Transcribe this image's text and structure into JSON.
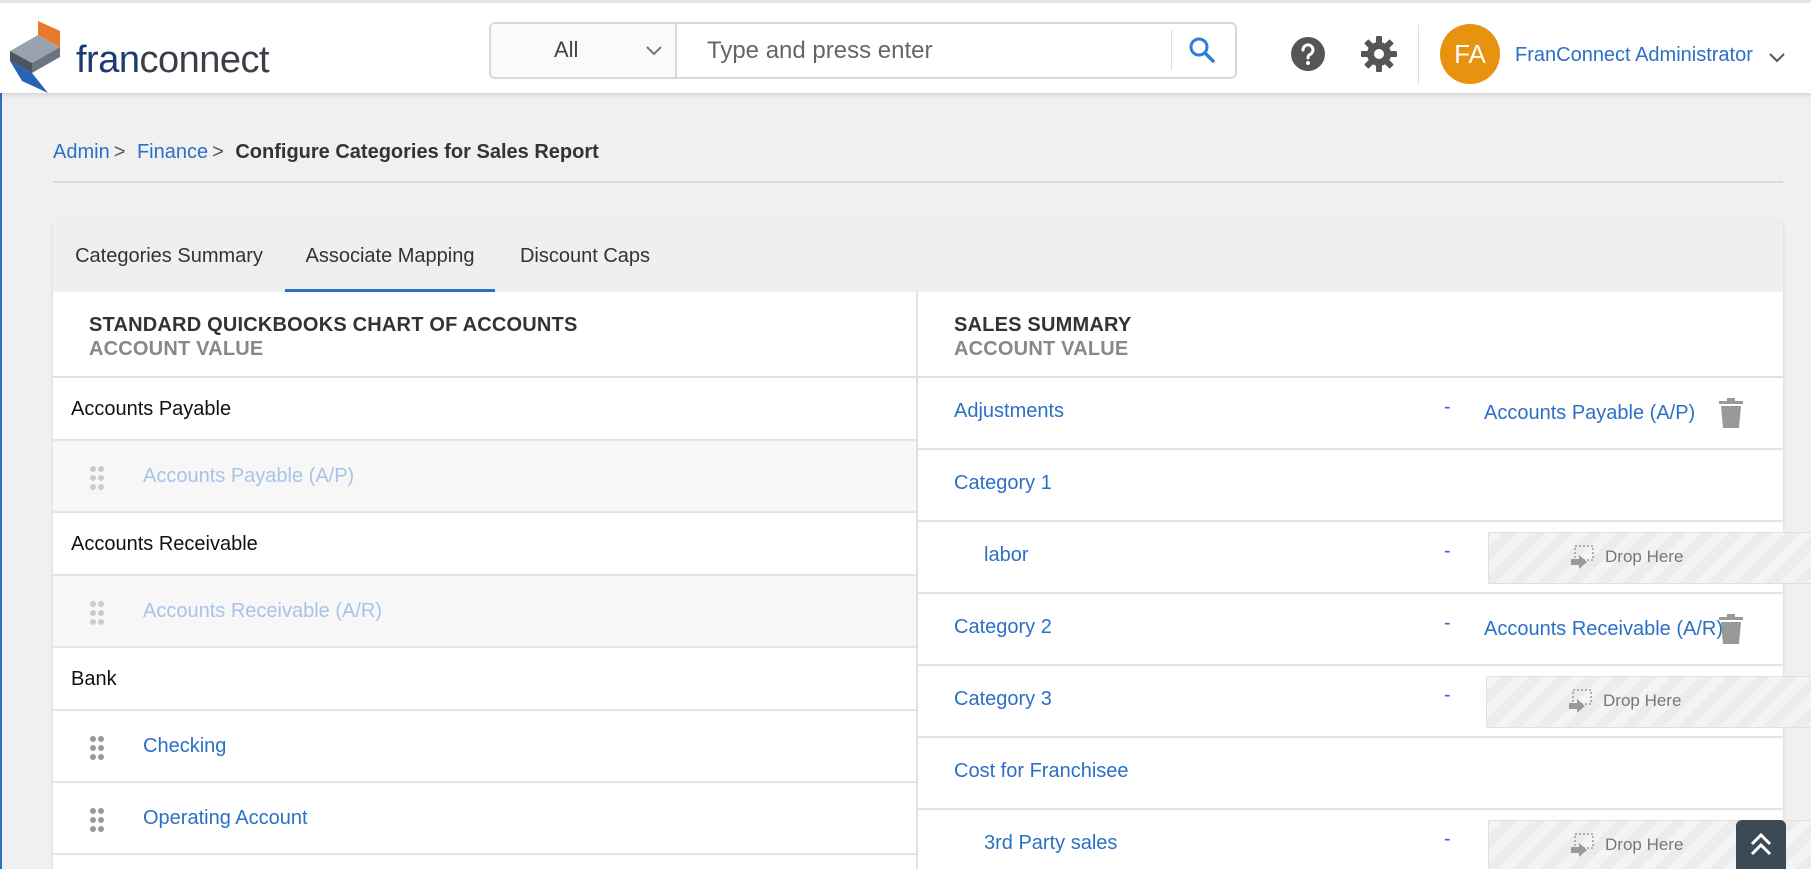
{
  "header": {
    "logo": {
      "part1": "fran",
      "part2": "connect"
    },
    "search": {
      "scope": "All",
      "placeholder": "Type and press enter"
    },
    "user": {
      "initials": "FA",
      "name": "FranConnect Administrator"
    }
  },
  "breadcrumb": {
    "items": [
      "Admin",
      "Finance"
    ],
    "current": "Configure Categories for Sales Report"
  },
  "tabs": [
    {
      "label": "Categories Summary",
      "active": false
    },
    {
      "label": "Associate Mapping",
      "active": true
    },
    {
      "label": "Discount Caps",
      "active": false
    }
  ],
  "left_panel": {
    "title": "STANDARD QUICKBOOKS CHART OF ACCOUNTS",
    "subtitle": "ACCOUNT VALUE",
    "rows": [
      {
        "type": "group",
        "label": "Accounts Payable"
      },
      {
        "type": "item",
        "label": "Accounts Payable (A/P)",
        "disabled": true
      },
      {
        "type": "group",
        "label": "Accounts Receivable"
      },
      {
        "type": "item",
        "label": "Accounts Receivable (A/R)",
        "disabled": true
      },
      {
        "type": "group",
        "label": "Bank"
      },
      {
        "type": "item",
        "label": "Checking",
        "disabled": false
      },
      {
        "type": "item",
        "label": "Operating Account",
        "disabled": false
      }
    ]
  },
  "right_panel": {
    "title": "SALES SUMMARY",
    "subtitle": "ACCOUNT VALUE",
    "drop_label": "Drop Here",
    "rows": [
      {
        "name": "Adjustments",
        "sub": false,
        "dash": "-",
        "mapped": "Accounts Payable (A/P)"
      },
      {
        "name": "Category 1",
        "sub": false,
        "dash": "",
        "mapped": ""
      },
      {
        "name": "labor",
        "sub": true,
        "dash": "-",
        "drop": true
      },
      {
        "name": "Category 2",
        "sub": false,
        "dash": "-",
        "mapped": "Accounts Receivable (A/R)"
      },
      {
        "name": "Category 3",
        "sub": false,
        "dash": "-",
        "drop": true
      },
      {
        "name": "Cost for Franchisee",
        "sub": false,
        "dash": "",
        "mapped": ""
      },
      {
        "name": "3rd Party sales",
        "sub": true,
        "dash": "-",
        "drop": true
      }
    ]
  },
  "colors": {
    "accent": "#2c6fc7",
    "avatar": "#e8930f"
  }
}
